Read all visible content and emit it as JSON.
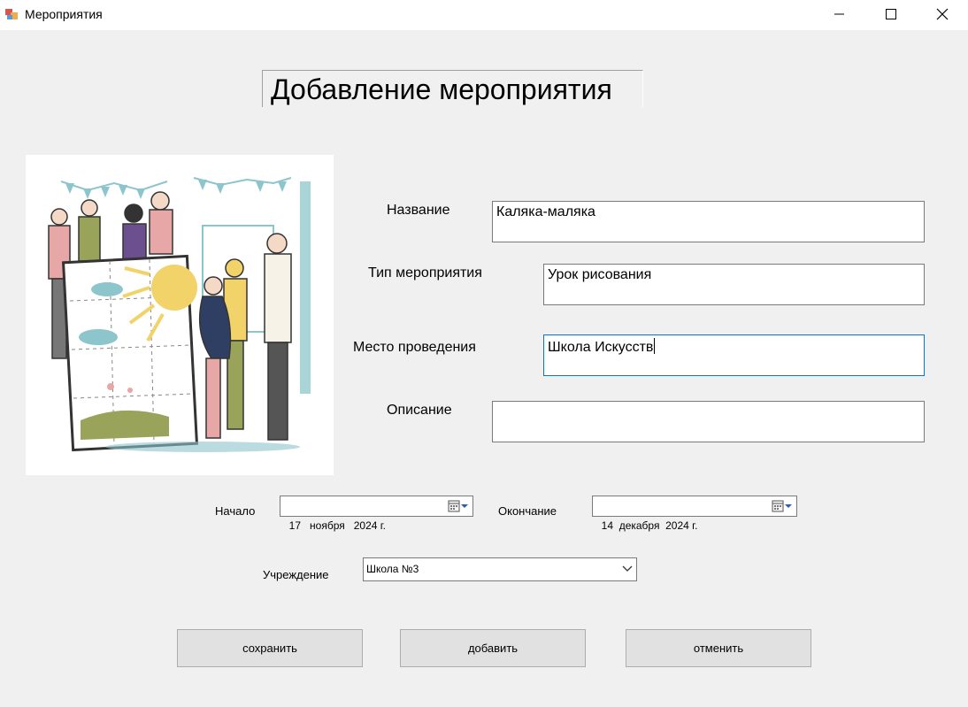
{
  "window": {
    "title": "Мероприятия",
    "controls": [
      "minimize",
      "maximize",
      "close"
    ]
  },
  "heading": "Добавление мероприятия",
  "form": {
    "name": {
      "label": "Название",
      "value": "Каляка-маляка"
    },
    "type": {
      "label": "Тип мероприятия",
      "value": "Урок рисования"
    },
    "place": {
      "label": "Место проведения",
      "value": "Школа Искусств"
    },
    "description": {
      "label": "Описание",
      "value": ""
    },
    "start": {
      "label": "Начало",
      "value": "17   ноября   2024 г."
    },
    "end": {
      "label": "Окончание",
      "value": "14  декабря  2024 г."
    },
    "institution": {
      "label": "Учреждение",
      "value": "Школа №3"
    }
  },
  "buttons": {
    "save": "сохранить",
    "add": "добавить",
    "cancel": "отменить"
  },
  "colors": {
    "background": "#f0f0f0",
    "focus_border": "#0078d7",
    "button_face": "#e1e1e1",
    "illustration_teal": "#8cc5cc",
    "illustration_yellow": "#f1d36a",
    "illustration_pink": "#e8a7a7",
    "illustration_olive": "#9aa35a"
  },
  "illustration": "people-holding-painting-icon"
}
